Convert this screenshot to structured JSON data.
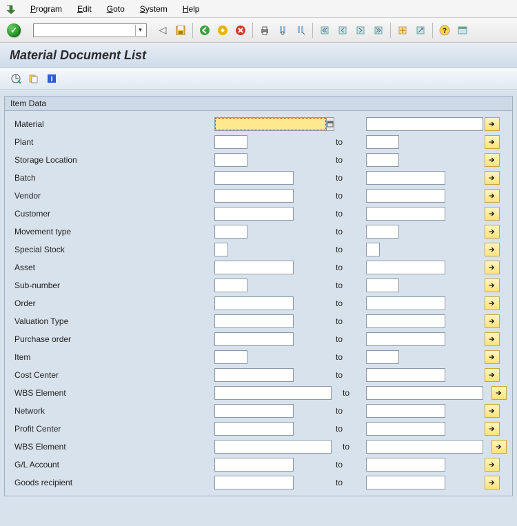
{
  "menu": {
    "items": [
      "Program",
      "Edit",
      "Goto",
      "System",
      "Help"
    ]
  },
  "title": "Material Document List",
  "group": {
    "title": "Item Data",
    "to_label": "to",
    "rows": [
      {
        "label": "Material",
        "from_w": "w-wide",
        "to_w": "w-wide",
        "highlight": true,
        "show_to": false,
        "f4": true
      },
      {
        "label": "Plant",
        "from_w": "w-short",
        "to_w": "w-short"
      },
      {
        "label": "Storage Location",
        "from_w": "w-short",
        "to_w": "w-short"
      },
      {
        "label": "Batch",
        "from_w": "w-med",
        "to_w": "w-med"
      },
      {
        "label": "Vendor",
        "from_w": "w-med",
        "to_w": "w-med"
      },
      {
        "label": "Customer",
        "from_w": "w-med",
        "to_w": "w-med"
      },
      {
        "label": "Movement type",
        "from_w": "w-short",
        "to_w": "w-short"
      },
      {
        "label": "Special Stock",
        "from_w": "w-tiny",
        "to_w": "w-tiny"
      },
      {
        "label": "Asset",
        "from_w": "w-med",
        "to_w": "w-med"
      },
      {
        "label": "Sub-number",
        "from_w": "w-short",
        "to_w": "w-short"
      },
      {
        "label": "Order",
        "from_w": "w-med",
        "to_w": "w-med"
      },
      {
        "label": "Valuation Type",
        "from_w": "w-med",
        "to_w": "w-med"
      },
      {
        "label": "Purchase order",
        "from_w": "w-med",
        "to_w": "w-med"
      },
      {
        "label": "Item",
        "from_w": "w-short",
        "to_w": "w-short"
      },
      {
        "label": "Cost Center",
        "from_w": "w-med",
        "to_w": "w-med"
      },
      {
        "label": "WBS Element",
        "from_w": "w-wide",
        "to_w": "w-wide",
        "wide": true
      },
      {
        "label": "Network",
        "from_w": "w-med",
        "to_w": "w-med"
      },
      {
        "label": "Profit Center",
        "from_w": "w-med",
        "to_w": "w-med"
      },
      {
        "label": "WBS Element",
        "from_w": "w-wide",
        "to_w": "w-wide",
        "wide": true
      },
      {
        "label": "G/L Account",
        "from_w": "w-med",
        "to_w": "w-med"
      },
      {
        "label": "Goods recipient",
        "from_w": "w-med",
        "to_w": "w-med"
      }
    ]
  }
}
